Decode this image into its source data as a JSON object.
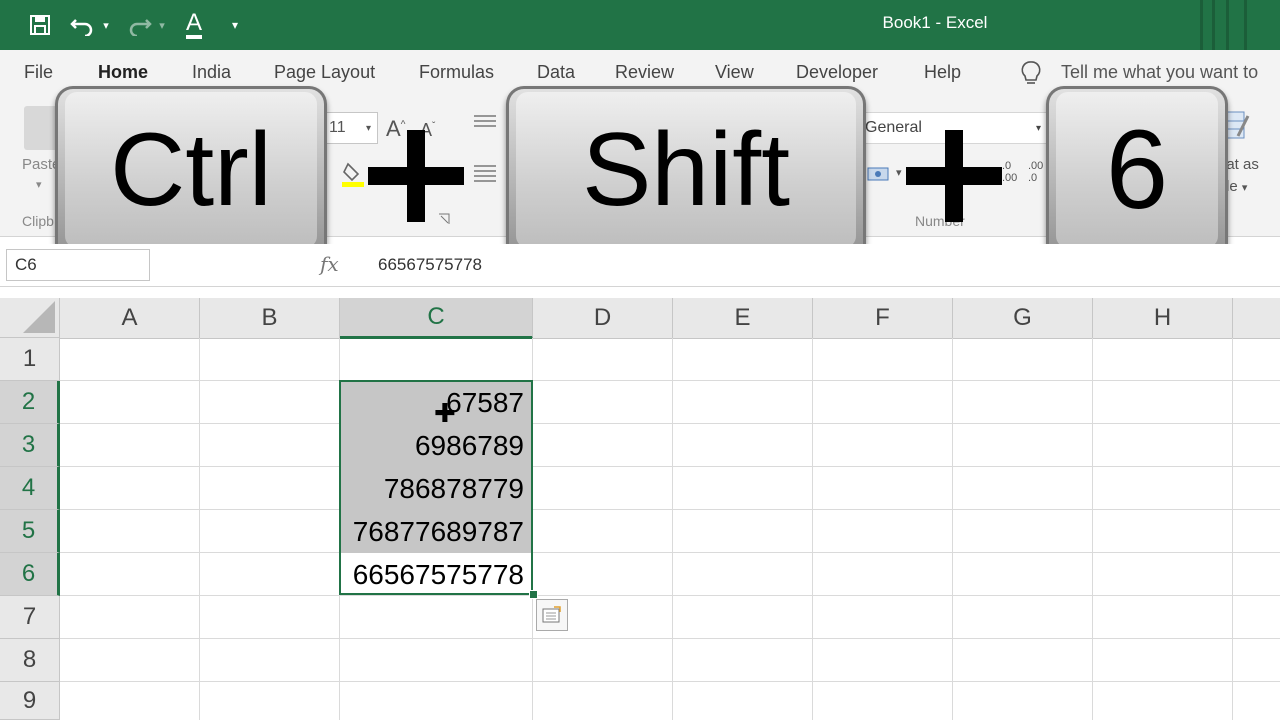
{
  "title_bar": {
    "title": "Book1  -  Excel",
    "qat_icons": [
      "save-icon",
      "undo-icon",
      "redo-icon",
      "font-color-icon",
      "customize-qat-icon"
    ],
    "accent": "#217346"
  },
  "tabs": [
    {
      "label": "File"
    },
    {
      "label": "Home",
      "active": true
    },
    {
      "label": "India"
    },
    {
      "label": "Page Layout"
    },
    {
      "label": "Formulas"
    },
    {
      "label": "Data"
    },
    {
      "label": "Review"
    },
    {
      "label": "View"
    },
    {
      "label": "Developer"
    },
    {
      "label": "Help"
    }
  ],
  "tell_me": {
    "text": "Tell me what you want to",
    "icon": "lightbulb-icon"
  },
  "ribbon": {
    "paste_label": "Paste",
    "clipboard_label": "Clipb",
    "font_size": "11",
    "number_format": "General",
    "number_group_label": "Number",
    "format_as_label": "nat as",
    "format_as_label2": "le",
    "decimal_inc": ".0\n.00",
    "decimal_dec": ".00\n.0"
  },
  "shortcut_overlay": {
    "keys": [
      "Ctrl",
      "Shift",
      "6"
    ],
    "separator": "+"
  },
  "formula_bar": {
    "name_box": "C6",
    "fx_label": "fx",
    "value": "66567575778"
  },
  "sheet": {
    "columns": [
      "A",
      "B",
      "C",
      "D",
      "E",
      "F",
      "G",
      "H"
    ],
    "selected_column": "C",
    "rows": [
      "1",
      "2",
      "3",
      "4",
      "5",
      "6",
      "7",
      "8",
      "9"
    ],
    "selected_rows": [
      "2",
      "3",
      "4",
      "5",
      "6"
    ],
    "column_c_values": [
      "67587",
      "6986789",
      "786878779",
      "76877689787",
      "66567575778"
    ],
    "selection_color": "#217346",
    "shaded_cell_color": "#c6c6c6"
  }
}
